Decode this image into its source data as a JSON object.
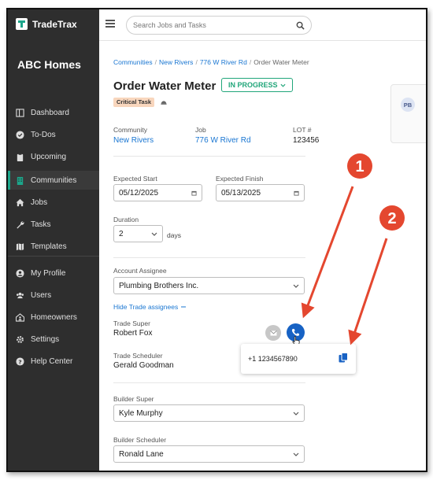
{
  "app": {
    "name": "TradeTrax",
    "company": "ABC Homes"
  },
  "sidebar": {
    "items": [
      {
        "label": "Dashboard",
        "icon": "dashboard-icon"
      },
      {
        "label": "To-Dos",
        "icon": "check-circle-icon"
      },
      {
        "label": "Upcoming",
        "icon": "clipboard-icon"
      },
      {
        "label": "Communities",
        "icon": "building-icon",
        "active": true
      },
      {
        "label": "Jobs",
        "icon": "home-icon"
      },
      {
        "label": "Tasks",
        "icon": "wrench-icon"
      },
      {
        "label": "Templates",
        "icon": "map-icon"
      },
      {
        "label": "My Profile",
        "icon": "user-circle-icon"
      },
      {
        "label": "Users",
        "icon": "users-icon"
      },
      {
        "label": "Homeowners",
        "icon": "house-user-icon"
      },
      {
        "label": "Settings",
        "icon": "gear-icon"
      },
      {
        "label": "Help Center",
        "icon": "question-circle-icon"
      }
    ]
  },
  "search": {
    "placeholder": "Search Jobs and Tasks"
  },
  "breadcrumb": [
    "Communities",
    "New Rivers",
    "776 W River Rd",
    "Order Water Meter"
  ],
  "task": {
    "title": "Order Water Meter",
    "status": "IN PROGRESS",
    "badge": "Critical Task"
  },
  "side_card": {
    "avatar_initials": "PB"
  },
  "info": {
    "community_label": "Community",
    "community_value": "New Rivers",
    "job_label": "Job",
    "job_value": "776 W River Rd",
    "lot_label": "LOT #",
    "lot_value": "123456"
  },
  "dates": {
    "start_label": "Expected Start",
    "start_value": "05/12/2025",
    "finish_label": "Expected Finish",
    "finish_value": "05/13/2025"
  },
  "duration": {
    "label": "Duration",
    "value": "2",
    "unit": "days"
  },
  "assignee": {
    "label": "Account Assignee",
    "value": "Plumbing Brothers Inc.",
    "hide_link": "Hide Trade assignees"
  },
  "trade_super": {
    "label": "Trade Super",
    "name": "Robert Fox"
  },
  "trade_scheduler": {
    "label": "Trade Scheduler",
    "name": "Gerald Goodman"
  },
  "phone_popover": {
    "number": "+1 1234567890"
  },
  "builder_super": {
    "label": "Builder Super",
    "value": "Kyle Murphy"
  },
  "builder_scheduler": {
    "label": "Builder Scheduler",
    "value": "Ronald Lane"
  },
  "annotations": [
    "1",
    "2"
  ],
  "colors": {
    "sidebar": "#2e2e2e",
    "accent": "#1ca58a",
    "link": "#1976d2",
    "phone": "#1762c4",
    "annotation": "#e4472f"
  }
}
